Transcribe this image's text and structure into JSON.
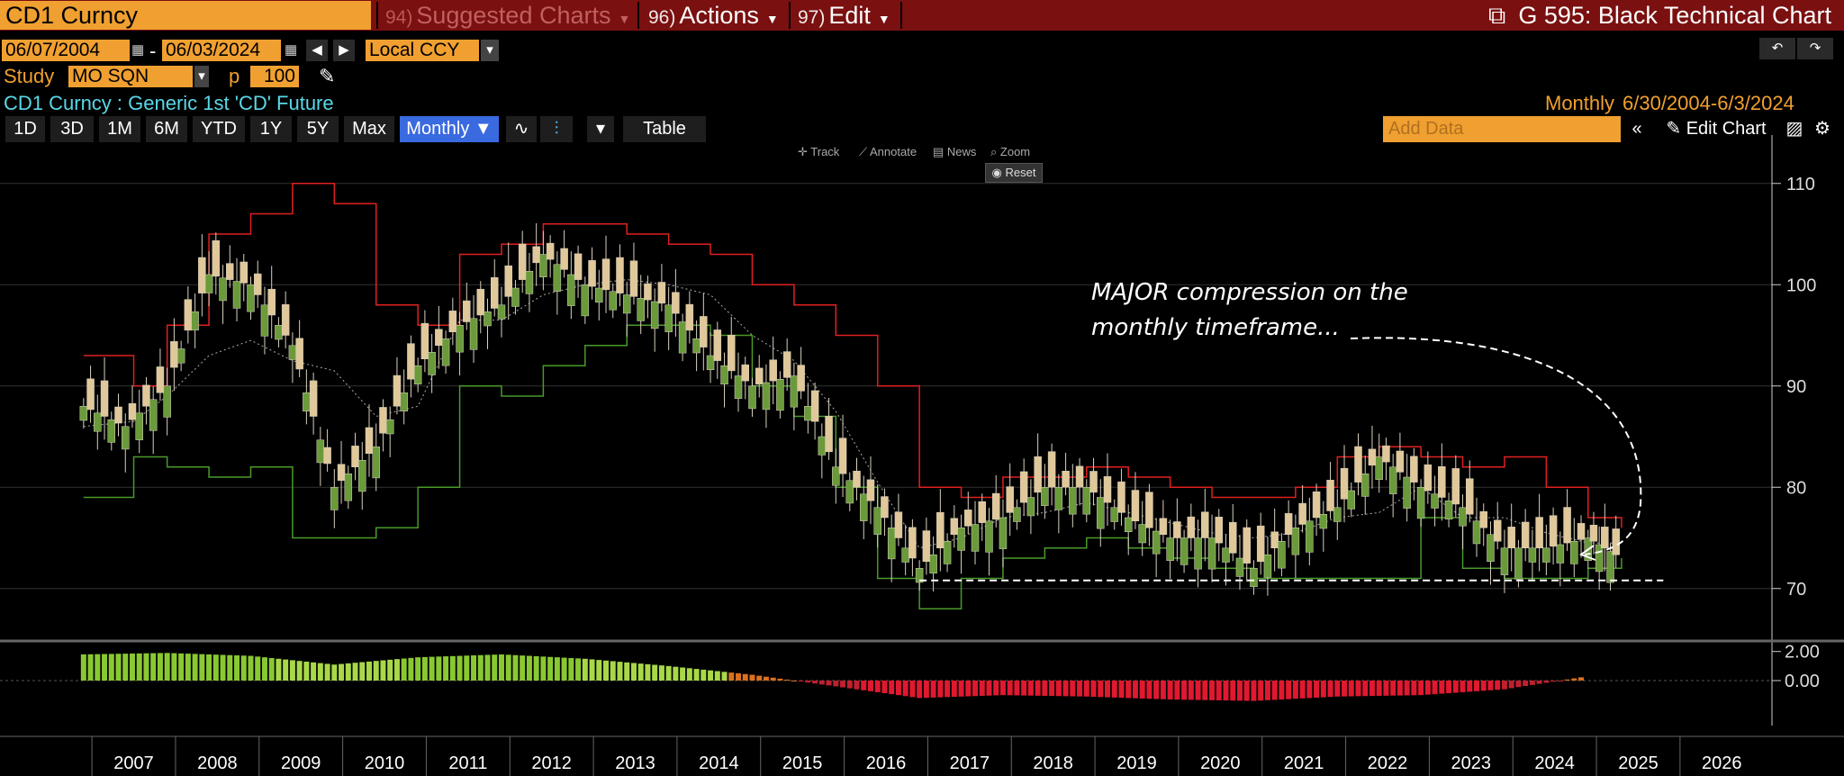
{
  "topbar": {
    "ticker": "CD1 Curncy",
    "suggested": {
      "num": "94)",
      "label": "Suggested Charts"
    },
    "actions": {
      "num": "96)",
      "label": "Actions"
    },
    "edit": {
      "num": "97)",
      "label": "Edit"
    },
    "function_title": "G 595: Black Technical Chart"
  },
  "controls": {
    "start_date": "06/07/2004",
    "end_date": "06/03/2024",
    "date_sep": "-",
    "currency": "Local CCY",
    "study_label": "Study",
    "study_value": "MO SQN",
    "p_label": "p",
    "p_value": "100"
  },
  "security": {
    "description": "CD1 Curncy : Generic 1st 'CD' Future",
    "freq_label": "Monthly",
    "range": "6/30/2004-6/3/2024"
  },
  "tabs": [
    "1D",
    "3D",
    "1M",
    "6M",
    "YTD",
    "1Y",
    "5Y",
    "Max"
  ],
  "period_select": "Monthly ▼",
  "table_btn": "Table",
  "add_data_placeholder": "Add Data",
  "edit_chart": "Edit Chart",
  "toolbar_mini": {
    "track": "Track",
    "annotate": "Annotate",
    "news": "News",
    "zoom": "Zoom",
    "reset": "Reset"
  },
  "annotation": {
    "line1": "MAJOR compression on the",
    "line2": "monthly timeframe..."
  },
  "colors": {
    "bg": "#000000",
    "upper_band": "#e02020",
    "lower_band": "#4a9a2a",
    "candle": "#e0c89a",
    "ticker_bg": "#f0a030",
    "topbar": "#7a1010"
  },
  "chart_data": {
    "type": "candlestick",
    "frequency": "Monthly",
    "x_ticks": [
      "2007",
      "2008",
      "2009",
      "2010",
      "2011",
      "2012",
      "2013",
      "2014",
      "2015",
      "2016",
      "2017",
      "2018",
      "2019",
      "2020",
      "2021",
      "2022",
      "2023",
      "2024",
      "2025",
      "2026"
    ],
    "y_ticks": [
      110,
      100,
      90,
      80,
      70
    ],
    "ylim": [
      65,
      113
    ],
    "lower_y_ticks": [
      "2.00",
      "0.00"
    ],
    "lower_ylim": [
      -2.6,
      2.6
    ],
    "series": [
      {
        "name": "Price",
        "type": "candlestick",
        "x": [
          2006.0,
          2006.5,
          2007.0,
          2007.5,
          2008.0,
          2008.5,
          2009.0,
          2009.5,
          2010.0,
          2010.5,
          2011.0,
          2011.5,
          2012.0,
          2012.5,
          2013.0,
          2013.5,
          2014.0,
          2014.5,
          2015.0,
          2015.5,
          2016.0,
          2016.5,
          2017.0,
          2017.5,
          2018.0,
          2018.5,
          2019.0,
          2019.5,
          2020.0,
          2020.5,
          2021.0,
          2021.5,
          2022.0,
          2022.5,
          2023.0,
          2023.5,
          2024.0,
          2024.4
        ],
        "y": [
          88,
          86,
          90,
          101,
          100,
          94,
          80,
          84,
          92,
          96,
          98,
          103,
          100,
          99,
          98,
          93,
          90,
          91,
          82,
          78,
          72,
          76,
          77,
          80,
          80,
          77,
          75,
          75,
          72,
          76,
          78,
          83,
          80,
          78,
          74,
          74,
          75,
          73
        ]
      },
      {
        "name": "Upper band",
        "type": "line",
        "x": [
          2006.0,
          2006.6,
          2007.0,
          2007.5,
          2008.0,
          2008.5,
          2009.0,
          2009.5,
          2010.0,
          2010.5,
          2011.0,
          2011.5,
          2012.0,
          2012.5,
          2013.0,
          2013.5,
          2014.0,
          2014.5,
          2015.0,
          2015.5,
          2016.0,
          2016.5,
          2017.0,
          2017.5,
          2018.0,
          2018.5,
          2019.0,
          2019.5,
          2020.0,
          2020.5,
          2021.0,
          2021.5,
          2022.0,
          2022.5,
          2023.0,
          2023.5,
          2024.0,
          2024.4
        ],
        "y": [
          93,
          90,
          96,
          105,
          107,
          110,
          108,
          98,
          96,
          103,
          104,
          106,
          106,
          105,
          104,
          103,
          100,
          98,
          95,
          90,
          80,
          79,
          81,
          81,
          82,
          81,
          80,
          79,
          79,
          80,
          83,
          84,
          83,
          82,
          83,
          80,
          77,
          76
        ]
      },
      {
        "name": "Lower band",
        "type": "line",
        "x": [
          2006.0,
          2006.6,
          2007.0,
          2007.5,
          2008.0,
          2008.5,
          2009.0,
          2009.5,
          2010.0,
          2010.5,
          2011.0,
          2011.5,
          2012.0,
          2012.5,
          2013.0,
          2013.5,
          2014.0,
          2014.5,
          2015.0,
          2015.5,
          2016.0,
          2016.5,
          2017.0,
          2017.5,
          2018.0,
          2018.5,
          2019.0,
          2019.5,
          2020.0,
          2020.5,
          2021.0,
          2021.5,
          2022.0,
          2022.5,
          2023.0,
          2023.5,
          2024.0,
          2024.4
        ],
        "y": [
          79,
          83,
          82,
          81,
          82,
          75,
          75,
          76,
          80,
          90,
          89,
          92,
          94,
          96,
          96,
          95,
          90,
          87,
          80,
          71,
          68,
          71,
          73,
          74,
          75,
          74,
          73,
          72,
          71,
          71,
          71,
          71,
          77,
          72,
          71,
          71,
          72,
          73
        ]
      },
      {
        "name": "Histogram",
        "type": "bar",
        "x": [
          2006.0,
          2007.0,
          2008.0,
          2009.0,
          2010.0,
          2011.0,
          2012.0,
          2013.0,
          2014.0,
          2015.0,
          2016.0,
          2017.0,
          2018.0,
          2019.0,
          2020.0,
          2021.0,
          2022.0,
          2023.0,
          2024.0
        ],
        "y": [
          1.8,
          1.9,
          1.7,
          1.1,
          1.6,
          1.8,
          1.5,
          1.0,
          0.4,
          -0.4,
          -1.2,
          -1.0,
          -1.1,
          -1.3,
          -1.4,
          -1.1,
          -1.0,
          -0.6,
          0.3
        ]
      }
    ],
    "support_line": 70.8
  }
}
